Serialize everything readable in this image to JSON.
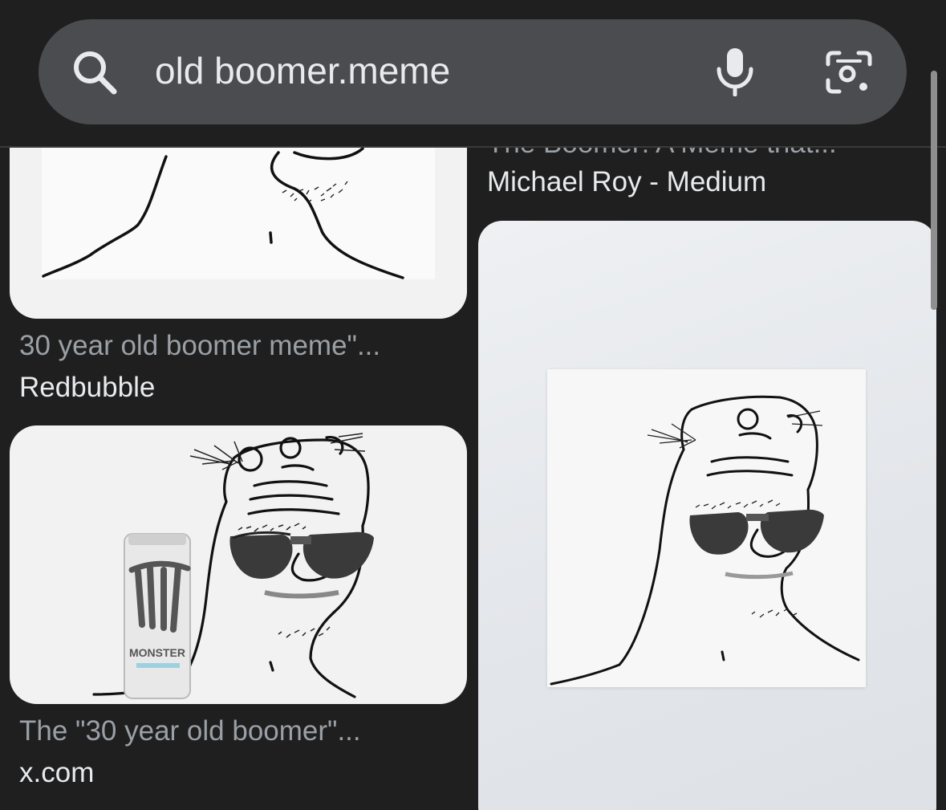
{
  "search": {
    "query": "old boomer.meme",
    "icons": {
      "search": "search-icon",
      "voice": "mic-icon",
      "lens": "google-lens-icon"
    }
  },
  "results": [
    {
      "title": "30 year old boomer meme\"...",
      "source": "Redbubble",
      "image": "boomer-meme-drawing"
    },
    {
      "title": "The \"30 year old boomer\"...",
      "source": "x.com",
      "image": "boomer-meme-sunglasses-monster-energy",
      "can_label": "MONSTER"
    },
    {
      "title": "The Boomer: A Meme that...",
      "source": "Michael Roy - Medium",
      "image": null
    },
    {
      "title": "",
      "source": "",
      "image": "boomer-meme-sunglasses-poster"
    }
  ],
  "colors": {
    "background": "#1f1f1f",
    "search_bar": "#4a4c4f",
    "primary_text": "#e8eaed",
    "secondary_text": "#9aa0a6"
  }
}
